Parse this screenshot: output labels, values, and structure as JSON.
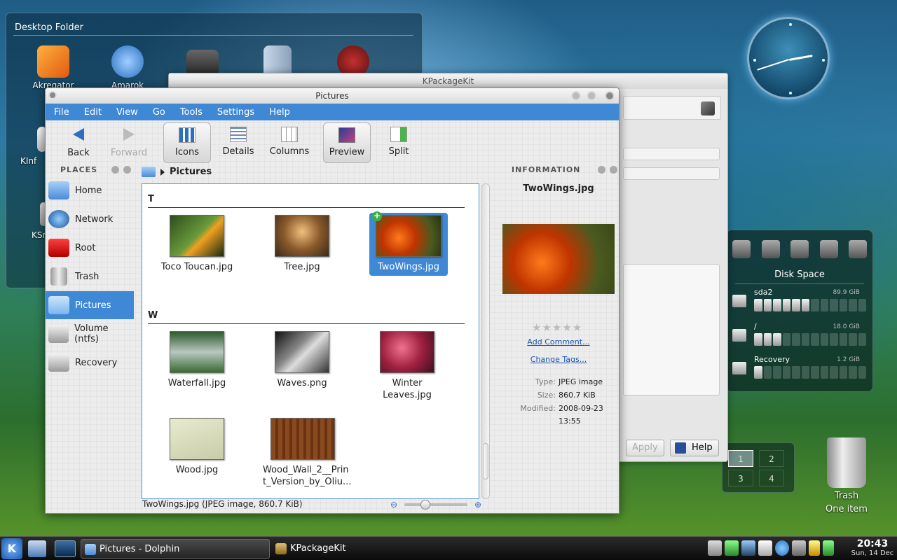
{
  "desktop_folder": {
    "title": "Desktop Folder",
    "icons": [
      {
        "label": "Akregator",
        "icon": "akregator-icon",
        "color": "#f07a20"
      },
      {
        "label": "Amarok",
        "icon": "amarok-icon",
        "color": "#3d7fd8"
      },
      {
        "label": "",
        "icon": "camera-icon",
        "color": "#444444"
      },
      {
        "label": "",
        "icon": "filing-cabinet-icon",
        "color": "#9ab0c8"
      },
      {
        "label": "",
        "icon": "clapperboard-icon",
        "color": "#b02020"
      }
    ],
    "partial_labels": [
      "KInf",
      "KSn"
    ]
  },
  "kpackagekit": {
    "title": "KPackageKit",
    "apply_label": "Apply",
    "help_label": "Help"
  },
  "dolphin": {
    "title": "Pictures",
    "menu": [
      "File",
      "Edit",
      "View",
      "Go",
      "Tools",
      "Settings",
      "Help"
    ],
    "toolbar": {
      "back": "Back",
      "forward": "Forward",
      "icons": "Icons",
      "details": "Details",
      "columns": "Columns",
      "preview": "Preview",
      "split": "Split"
    },
    "places_header": "PLACES",
    "places": [
      {
        "label": "Home",
        "icon": "home-folder-icon",
        "color": "#6aa6e8"
      },
      {
        "label": "Network",
        "icon": "network-globe-icon",
        "color": "#2a6fc0"
      },
      {
        "label": "Root",
        "icon": "root-folder-icon",
        "color": "#d81c1c"
      },
      {
        "label": "Trash",
        "icon": "trash-icon",
        "color": "#b8b8b8"
      },
      {
        "label": "Pictures",
        "icon": "pictures-folder-icon",
        "color": "#8cc4f4"
      },
      {
        "label": "Volume (ntfs)",
        "icon": "drive-icon",
        "color": "#cfcfcf"
      },
      {
        "label": "Recovery",
        "icon": "drive-icon",
        "color": "#cfcfcf"
      }
    ],
    "breadcrumb": "Pictures",
    "groups": [
      {
        "letter": "T",
        "items": [
          {
            "name": "Toco Toucan.jpg",
            "thumb": "toucan-thumb",
            "color": "#3d6a2a"
          },
          {
            "name": "Tree.jpg",
            "thumb": "tree-thumb",
            "color": "#b07a3a"
          },
          {
            "name": "TwoWings.jpg",
            "thumb": "twowings-thumb",
            "color": "#d85410"
          }
        ]
      },
      {
        "letter": "W",
        "items": [
          {
            "name": "Waterfall.jpg",
            "thumb": "waterfall-thumb",
            "color": "#4b7a3c"
          },
          {
            "name": "Waves.png",
            "thumb": "waves-thumb",
            "color": "#555555"
          },
          {
            "name": "Winter Leaves.jpg",
            "thumb": "winter-leaves-thumb",
            "color": "#b03050"
          },
          {
            "name": "Wood.jpg",
            "thumb": "wood-thumb",
            "color": "#dcdcc0"
          },
          {
            "name_line1": "Wood_Wall_2__Prin",
            "name_line2": "t_Version_by_Oliu...",
            "thumb": "wood-wall-thumb",
            "color": "#7a3f1a"
          }
        ]
      }
    ],
    "information": {
      "header": "INFORMATION",
      "file_name": "TwoWings.jpg",
      "add_comment": "Add Comment...",
      "change_tags": "Change Tags...",
      "type_label": "Type:",
      "type_value": "JPEG image",
      "size_label": "Size:",
      "size_value": "860.7 KiB",
      "modified_label": "Modified:",
      "modified_date": "2008-09-23",
      "modified_time": "13:55",
      "rating": 0
    },
    "status": "TwoWings.jpg (JPEG image, 860.7 KiB)",
    "zoom_fraction": 0.3
  },
  "disk_space": {
    "title": "Disk Space",
    "drives": [
      {
        "name": "sda2",
        "size": "89.9 GiB",
        "fill_segments": 6
      },
      {
        "name": "/",
        "size": "18.0 GiB",
        "fill_segments": 3
      },
      {
        "name": "Recovery",
        "size": "1.2 GiB",
        "fill_segments": 1
      }
    ]
  },
  "pager": {
    "desktops": [
      "1",
      "2",
      "3",
      "4"
    ],
    "active": "1"
  },
  "desktop_trash": {
    "label": "Trash",
    "sub": "One item"
  },
  "taskbar": {
    "start_glyph": "K",
    "tasks": [
      {
        "label": "Pictures - Dolphin",
        "active": true
      },
      {
        "label": "KPackageKit",
        "active": false
      }
    ],
    "time": "20:43",
    "date": "Sun, 14 Dec"
  }
}
